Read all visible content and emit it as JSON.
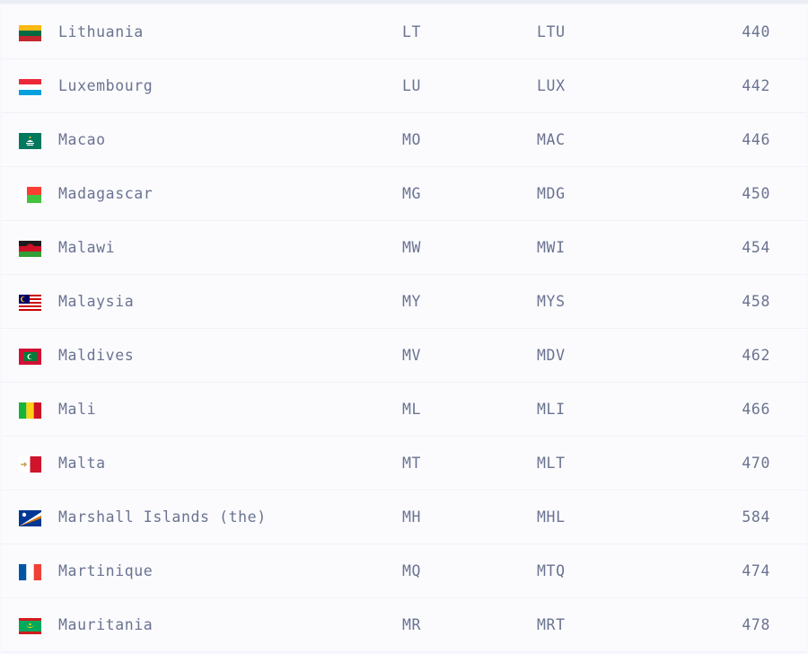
{
  "countries": [
    {
      "name": "Lithuania",
      "alpha2": "LT",
      "alpha3": "LTU",
      "numeric": "440",
      "flag_icon": "flag-lithuania-icon"
    },
    {
      "name": "Luxembourg",
      "alpha2": "LU",
      "alpha3": "LUX",
      "numeric": "442",
      "flag_icon": "flag-luxembourg-icon"
    },
    {
      "name": "Macao",
      "alpha2": "MO",
      "alpha3": "MAC",
      "numeric": "446",
      "flag_icon": "flag-macao-icon"
    },
    {
      "name": "Madagascar",
      "alpha2": "MG",
      "alpha3": "MDG",
      "numeric": "450",
      "flag_icon": "flag-madagascar-icon"
    },
    {
      "name": "Malawi",
      "alpha2": "MW",
      "alpha3": "MWI",
      "numeric": "454",
      "flag_icon": "flag-malawi-icon"
    },
    {
      "name": "Malaysia",
      "alpha2": "MY",
      "alpha3": "MYS",
      "numeric": "458",
      "flag_icon": "flag-malaysia-icon"
    },
    {
      "name": "Maldives",
      "alpha2": "MV",
      "alpha3": "MDV",
      "numeric": "462",
      "flag_icon": "flag-maldives-icon"
    },
    {
      "name": "Mali",
      "alpha2": "ML",
      "alpha3": "MLI",
      "numeric": "466",
      "flag_icon": "flag-mali-icon"
    },
    {
      "name": "Malta",
      "alpha2": "MT",
      "alpha3": "MLT",
      "numeric": "470",
      "flag_icon": "flag-malta-icon"
    },
    {
      "name": "Marshall Islands (the)",
      "alpha2": "MH",
      "alpha3": "MHL",
      "numeric": "584",
      "flag_icon": "flag-marshall-islands-icon"
    },
    {
      "name": "Martinique",
      "alpha2": "MQ",
      "alpha3": "MTQ",
      "numeric": "474",
      "flag_icon": "flag-martinique-icon"
    },
    {
      "name": "Mauritania",
      "alpha2": "MR",
      "alpha3": "MRT",
      "numeric": "478",
      "flag_icon": "flag-mauritania-icon"
    }
  ],
  "colors": {
    "background": "#f7f8fd",
    "row_background": "#fbfbfe",
    "text": "#6a7390"
  }
}
